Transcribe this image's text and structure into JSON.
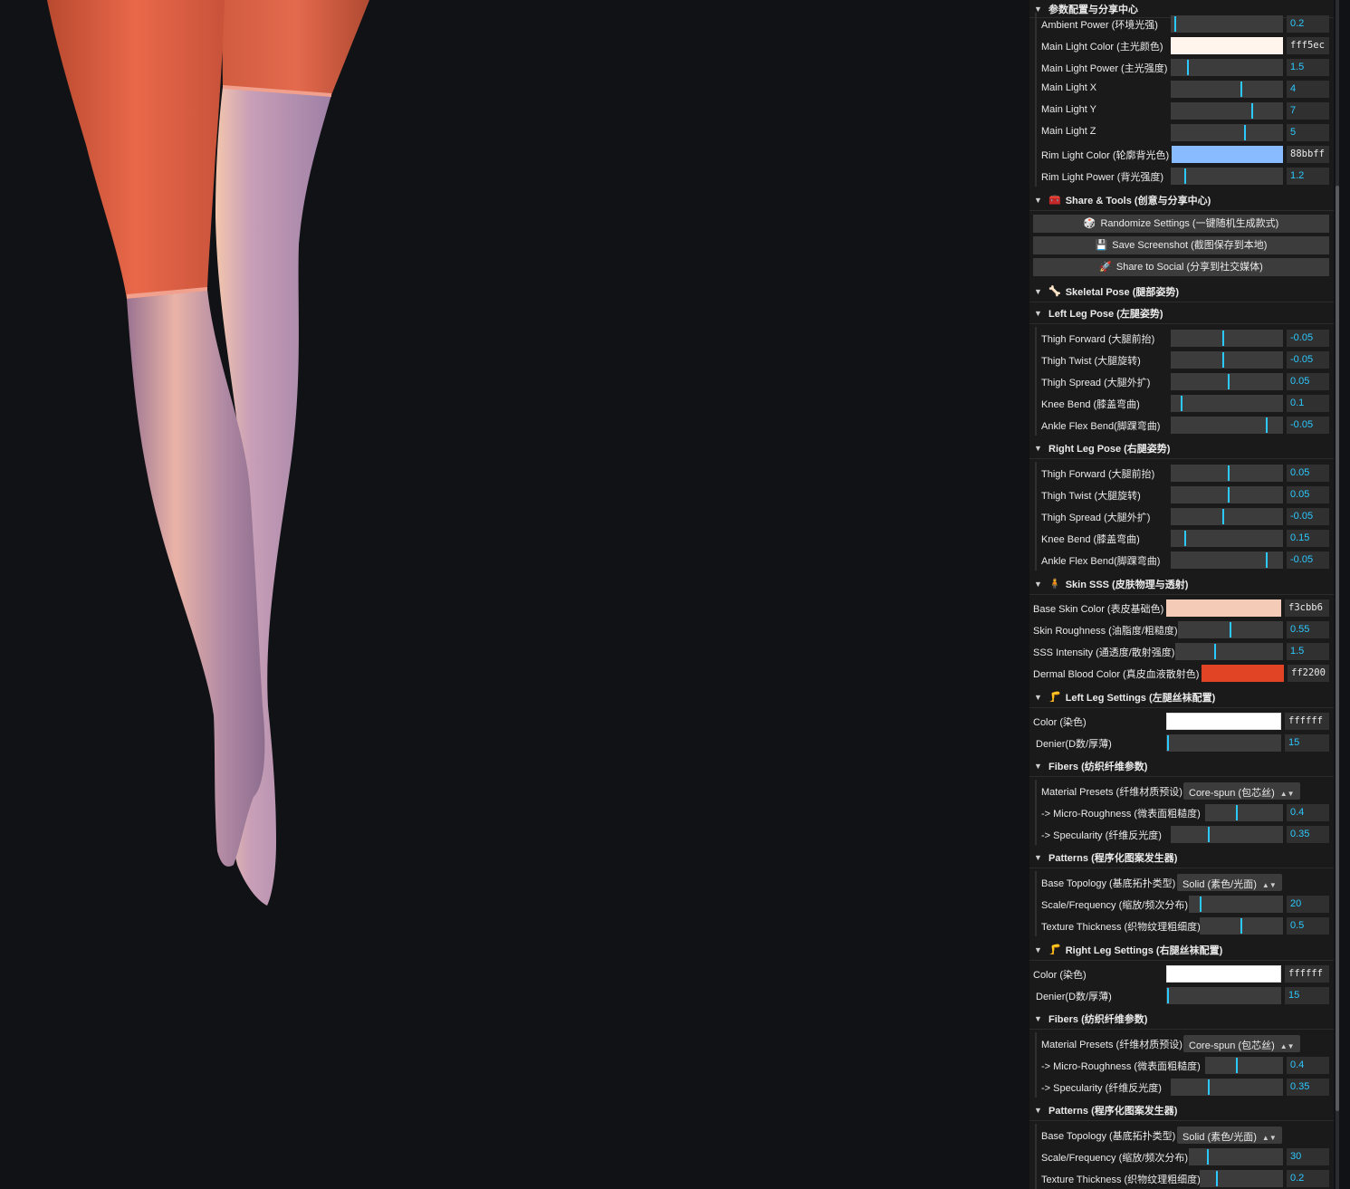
{
  "panel": {
    "root_title": "参数配置与分享中心",
    "lighting": {
      "ambient_power": {
        "label": "Ambient Power (环境光强)",
        "value": "0.2",
        "fraction": 0.03
      },
      "main_light_color": {
        "label": "Main Light Color (主光颜色)",
        "hex": "fff5ec",
        "color": "#fff5ec"
      },
      "main_light_power": {
        "label": "Main Light Power (主光强度)",
        "value": "1.5",
        "fraction": 0.15
      },
      "main_light_x": {
        "label": "Main Light X",
        "value": "4",
        "fraction": 0.63
      },
      "main_light_y": {
        "label": "Main Light Y",
        "value": "7",
        "fraction": 0.73
      },
      "main_light_z": {
        "label": "Main Light Z",
        "value": "5",
        "fraction": 0.66
      },
      "rim_light_color": {
        "label": "Rim Light Color (轮廓背光色)",
        "hex": "88bbff",
        "color": "#88bbff"
      },
      "rim_light_power": {
        "label": "Rim Light Power (背光强度)",
        "value": "1.2",
        "fraction": 0.12
      }
    },
    "share_tools": {
      "title": "Share & Tools (创意与分享中心)",
      "icon": "toolbox-icon",
      "randomize": "Randomize Settings (一键随机生成款式)",
      "save": "Save Screenshot (截图保存到本地)",
      "share": "Share to Social (分享到社交媒体)"
    },
    "skeletal_pose": {
      "title": "Skeletal Pose (腿部姿势)",
      "left_leg": {
        "title": "Left Leg Pose (左腿姿势)",
        "thigh_forward": {
          "label": "Thigh Forward (大腿前抬)",
          "value": "-0.05",
          "fraction": 0.47
        },
        "thigh_twist": {
          "label": "Thigh Twist (大腿旋转)",
          "value": "-0.05",
          "fraction": 0.47
        },
        "thigh_spread": {
          "label": "Thigh Spread (大腿外扩)",
          "value": "0.05",
          "fraction": 0.52
        },
        "knee_bend": {
          "label": "Knee Bend (膝盖弯曲)",
          "value": "0.1",
          "fraction": 0.09
        },
        "ankle_flex": {
          "label": "Ankle Flex Bend(脚踝弯曲)",
          "value": "-0.05",
          "fraction": 0.86
        }
      },
      "right_leg": {
        "title": "Right Leg Pose (右腿姿势)",
        "thigh_forward": {
          "label": "Thigh Forward (大腿前抬)",
          "value": "0.05",
          "fraction": 0.52
        },
        "thigh_twist": {
          "label": "Thigh Twist (大腿旋转)",
          "value": "0.05",
          "fraction": 0.52
        },
        "thigh_spread": {
          "label": "Thigh Spread (大腿外扩)",
          "value": "-0.05",
          "fraction": 0.47
        },
        "knee_bend": {
          "label": "Knee Bend (膝盖弯曲)",
          "value": "0.15",
          "fraction": 0.12
        },
        "ankle_flex": {
          "label": "Ankle Flex Bend(脚踝弯曲)",
          "value": "-0.05",
          "fraction": 0.86
        }
      }
    },
    "skin_sss": {
      "title": "Skin SSS (皮肤物理与透射)",
      "base_color": {
        "label": "Base Skin Color (表皮基础色)",
        "hex": "f3cbb6",
        "color": "#f3cbb6"
      },
      "roughness": {
        "label": "Skin Roughness (油脂度/粗糙度)",
        "value": "0.55",
        "fraction": 0.5
      },
      "sss_intensity": {
        "label": "SSS Intensity (通透度/散射强度)",
        "value": "1.5",
        "fraction": 0.37
      },
      "blood_color": {
        "label": "Dermal Blood Color (真皮血液散射色)",
        "hex": "ff2200",
        "color": "#e04424"
      }
    },
    "left_leg_settings": {
      "title": "Left Leg Settings (左腿丝袜配置)",
      "color": {
        "label": "Color (染色)",
        "hex": "ffffff",
        "color": "#ffffff"
      },
      "denier": {
        "label": "Denier(D数/厚薄)",
        "value": "15",
        "fraction": 0.01
      },
      "fibers": {
        "title": "Fibers (纺织纤维参数)",
        "material": {
          "label": "Material Presets (纤维材质预设)",
          "value": "Core-spun (包芯丝)"
        },
        "micro_roughness": {
          "label": "-> Micro-Roughness (微表面粗糙度)",
          "value": "0.4",
          "fraction": 0.4
        },
        "specularity": {
          "label": "-> Specularity (纤维反光度)",
          "value": "0.35",
          "fraction": 0.34
        }
      },
      "patterns": {
        "title": "Patterns (程序化图案发生器)",
        "topology": {
          "label": "Base Topology (基底拓扑类型)",
          "value": "Solid (素色/光面)"
        },
        "scale": {
          "label": "Scale/Frequency (缩放/频次分布)",
          "value": "20",
          "fraction": 0.12
        },
        "thickness": {
          "label": "Texture Thickness (织物纹理粗细度)",
          "value": "0.5",
          "fraction": 0.5
        }
      }
    },
    "right_leg_settings": {
      "title": "Right Leg Settings (右腿丝袜配置)",
      "color": {
        "label": "Color (染色)",
        "hex": "ffffff",
        "color": "#ffffff"
      },
      "denier": {
        "label": "Denier(D数/厚薄)",
        "value": "15",
        "fraction": 0.01
      },
      "fibers": {
        "title": "Fibers (纺织纤维参数)",
        "material": {
          "label": "Material Presets (纤维材质预设)",
          "value": "Core-spun (包芯丝)"
        },
        "micro_roughness": {
          "label": "-> Micro-Roughness (微表面粗糙度)",
          "value": "0.4",
          "fraction": 0.4
        },
        "specularity": {
          "label": "-> Specularity (纤维反光度)",
          "value": "0.35",
          "fraction": 0.34
        }
      },
      "patterns": {
        "title": "Patterns (程序化图案发生器)",
        "topology": {
          "label": "Base Topology (基底拓扑类型)",
          "value": "Solid (素色/光面)"
        },
        "scale": {
          "label": "Scale/Frequency (缩放/频次分布)",
          "value": "30",
          "fraction": 0.2
        },
        "thickness": {
          "label": "Texture Thickness (织物纹理粗细度)",
          "value": "0.2",
          "fraction": 0.2
        }
      }
    }
  }
}
